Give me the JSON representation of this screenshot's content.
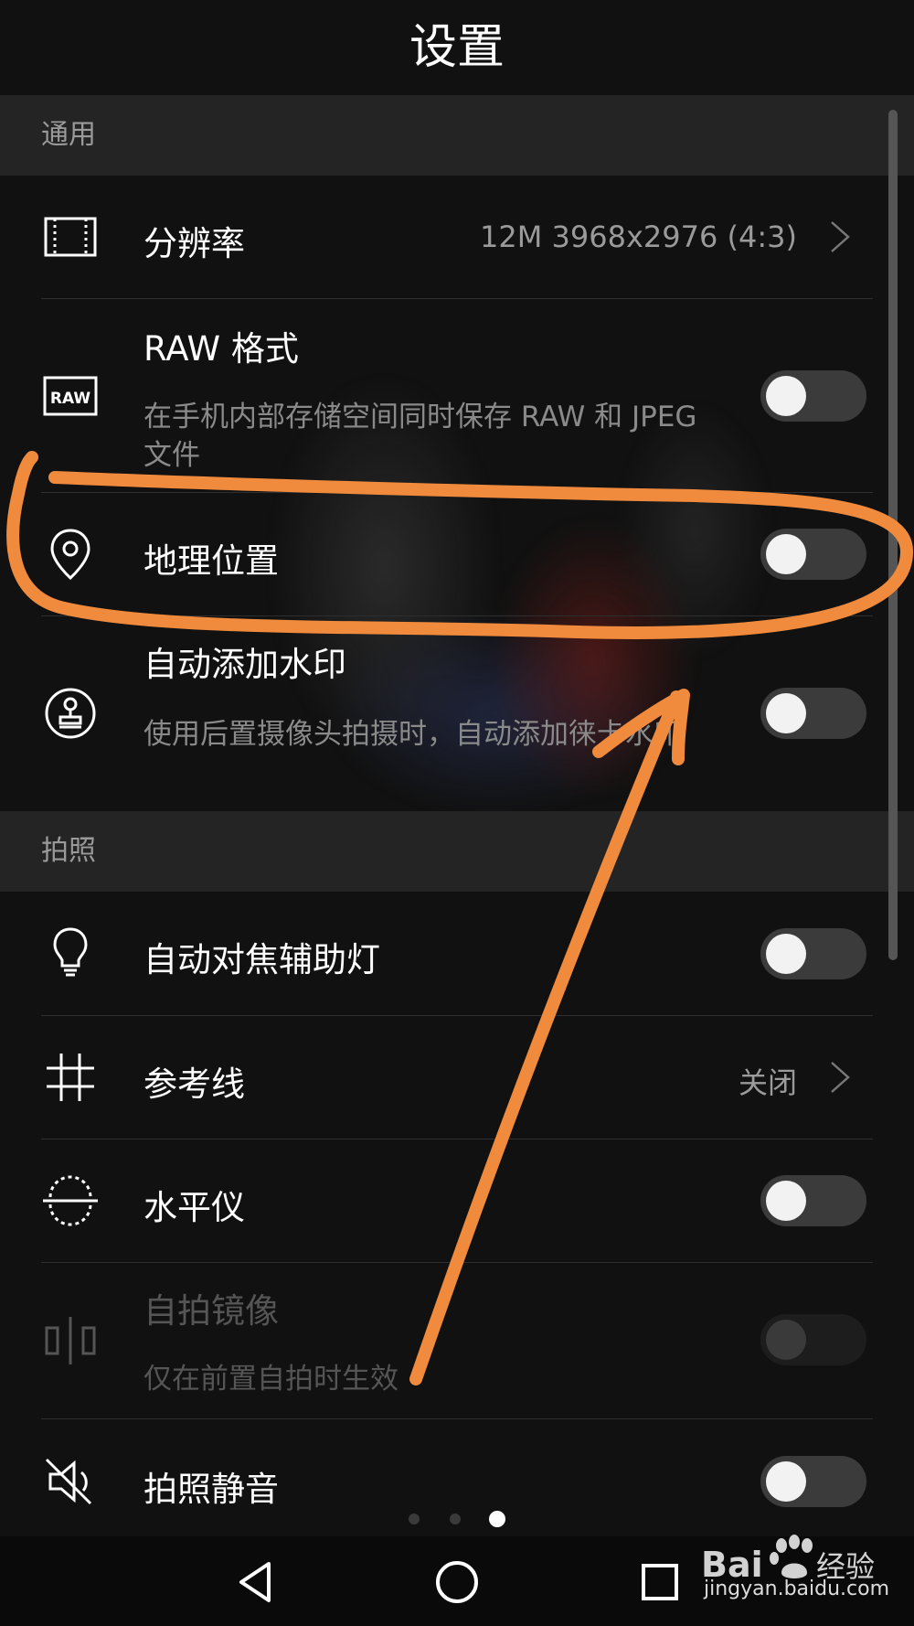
{
  "header": {
    "title": "设置"
  },
  "sections": {
    "general": "通用",
    "photo": "拍照"
  },
  "rows": {
    "resolution": {
      "label": "分辨率",
      "value": "12M 3968x2976 (4:3)",
      "icon": "resolution-frame-icon"
    },
    "raw": {
      "label": "RAW 格式",
      "subtitle": "在手机内部存储空间同时保存 RAW 和 JPEG 文件",
      "icon": "raw-icon",
      "enabled": false
    },
    "location": {
      "label": "地理位置",
      "icon": "location-pin-icon",
      "enabled": false
    },
    "watermark": {
      "label": "自动添加水印",
      "subtitle": "使用后置摄像头拍摄时，自动添加徕卡水印",
      "icon": "stamp-icon",
      "enabled": false
    },
    "af_light": {
      "label": "自动对焦辅助灯",
      "icon": "lightbulb-icon",
      "enabled": false
    },
    "grid": {
      "label": "参考线",
      "value": "关闭",
      "icon": "grid-icon"
    },
    "level": {
      "label": "水平仪",
      "icon": "level-icon",
      "enabled": false
    },
    "mirror": {
      "label": "自拍镜像",
      "subtitle": "仅在前置自拍时生效",
      "icon": "mirror-icon",
      "enabled": false,
      "disabled": true
    },
    "mute": {
      "label": "拍照静音",
      "icon": "mute-speaker-icon",
      "enabled": false
    }
  },
  "page_indicator": {
    "count": 3,
    "active": 3
  },
  "navigation": {
    "back": "back-triangle-icon",
    "home": "home-circle-icon",
    "recents": "recents-square-icon"
  },
  "watermark_brand": {
    "text": "jingyan.baidu.com",
    "logo": "Bai经验"
  },
  "colors": {
    "annotation": "#f08a3c",
    "background": "#111111",
    "toggle_off": "#3b3b3b"
  }
}
